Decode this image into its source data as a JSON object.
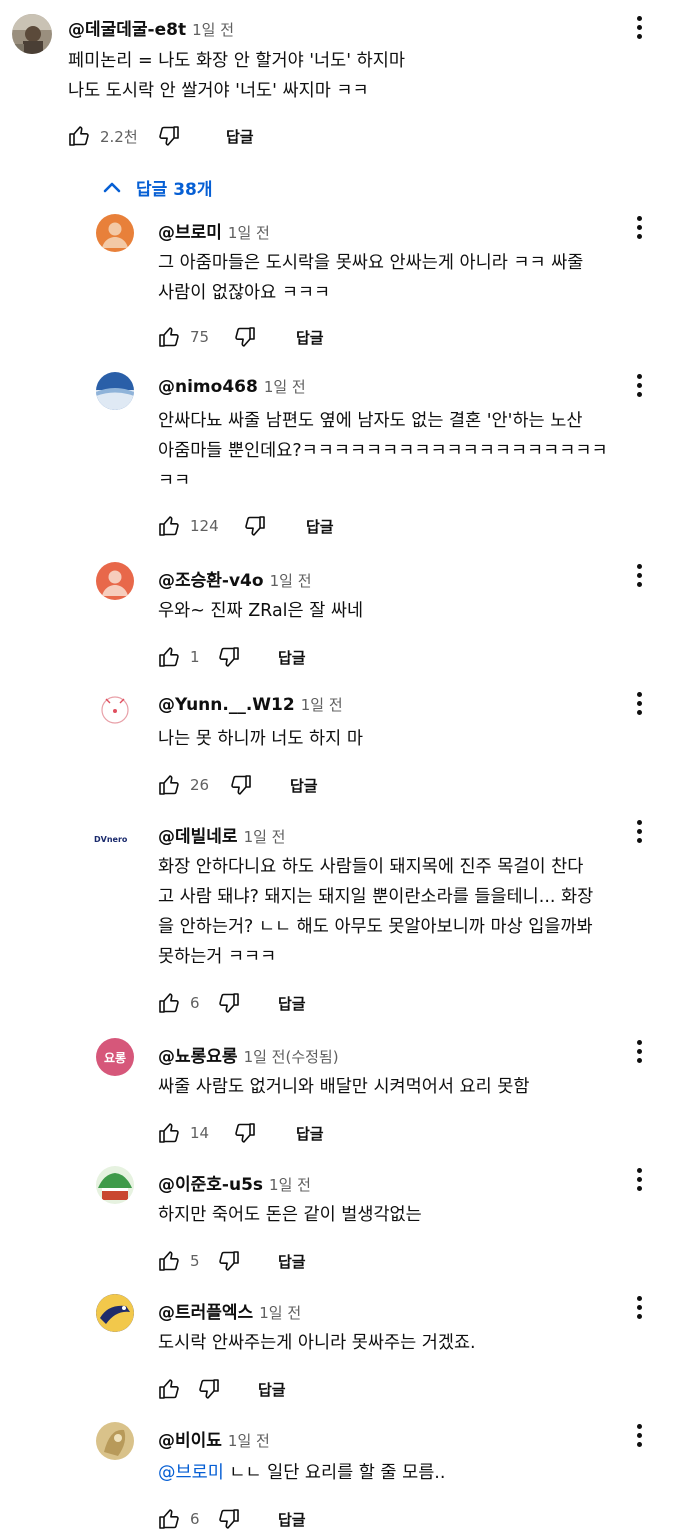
{
  "colors": {
    "link_blue": "#065fd4",
    "secondary_text": "#606060",
    "primary_text": "#0f0f0f"
  },
  "icons": {
    "like": "thumb-up-icon",
    "dislike": "thumb-down-icon",
    "more": "more-vert-icon",
    "collapse": "chevron-up-icon"
  },
  "reply_label": "답글",
  "main_comment": {
    "author": "@데굴데굴-e8t",
    "time": "1일 전",
    "text": "페미논리 = 나도 화장 안 할거야 '너도' 하지마\n나도 도시락 안 쌀거야 '너도' 싸지마 ㅋㅋ",
    "likes": "2.2천"
  },
  "replies_toggle": {
    "label": "답글 38개"
  },
  "replies": [
    {
      "author": "@브로미",
      "time": "1일 전",
      "text": "그 아줌마들은 도시락을 못싸요 안싸는게 아니라 ㅋㅋ 싸줄\n사람이 없잖아요 ㅋㅋㅋ",
      "likes": "75"
    },
    {
      "author": "@nimo468",
      "time": "1일 전",
      "text": "안싸다뇨 싸줄 남편도 옆에 남자도 없는 결혼 '안'하는 노산\n아줌마들 뿐인데요?ㅋㅋㅋㅋㅋㅋㅋㅋㅋㅋㅋㅋㅋㅋㅋㅋㅋㅋㅋ\nㅋㅋ",
      "likes": "124"
    },
    {
      "author": "@조승환-v4o",
      "time": "1일 전",
      "text": "우와~ 진짜 ZRal은 잘 싸네",
      "likes": "1"
    },
    {
      "author": "@Yunn.__.W12",
      "time": "1일 전",
      "text": "나는 못 하니까 너도 하지 마",
      "likes": "26"
    },
    {
      "author": "@데빌네로",
      "time": "1일 전",
      "avatar_text": "DVnero",
      "text": "화장 안하다니요 하도 사람들이 돼지목에 진주 목걸이 찬다\n고 사람 돼냐? 돼지는 돼지일 뿐이란소라를 들을테니... 화장\n을 안하는거? ㄴㄴ 해도 아무도 못알아보니까 마상 입을까봐\n못하는거 ㅋㅋㅋ",
      "likes": "6"
    },
    {
      "author": "@뇨롱요롱",
      "time": "1일 전(수정됨)",
      "avatar_text": "요롱",
      "text": "싸줄 사람도 없거니와 배달만 시켜먹어서 요리 못함",
      "likes": "14"
    },
    {
      "author": "@이준호-u5s",
      "time": "1일 전",
      "text": "하지만 죽어도 돈은 같이 벌생각없는",
      "likes": "5"
    },
    {
      "author": "@트러플엑스",
      "time": "1일 전",
      "text": "도시락 안싸주는게 아니라 못싸주는 거겠죠.",
      "likes": ""
    },
    {
      "author": "@비이됴",
      "time": "1일 전",
      "mention": "@브로미",
      "text": " ㄴㄴ 일단 요리를 할 줄 모름..",
      "likes": "6"
    }
  ]
}
